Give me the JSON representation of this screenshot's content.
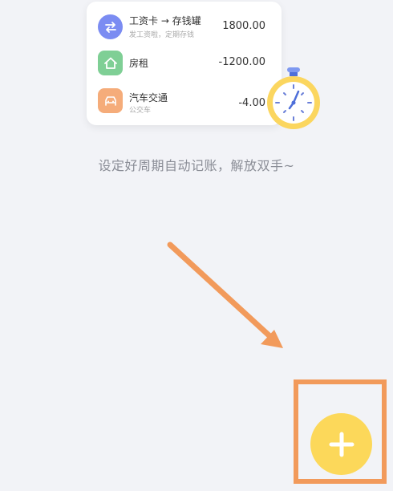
{
  "transactions": [
    {
      "title": "工资卡 → 存钱罐",
      "subtitle": "发工资啦，定期存钱",
      "amount": "1800.00",
      "icon": "transfer-icon",
      "icon_color": "#7b8cf2"
    },
    {
      "title": "房租",
      "subtitle": "",
      "amount": "-1200.00",
      "icon": "house-icon",
      "icon_color": "#7fcf95"
    },
    {
      "title": "汽车交通",
      "subtitle": "公交车",
      "amount": "-4.00",
      "icon": "car-icon",
      "icon_color": "#f5ac7a"
    }
  ],
  "tip_text": "设定好周期自动记账，解放双手~",
  "fab": {
    "icon": "plus-icon",
    "color": "#fcd85a"
  },
  "highlight_color": "#f29a5b",
  "arrow_color": "#f29a5b"
}
